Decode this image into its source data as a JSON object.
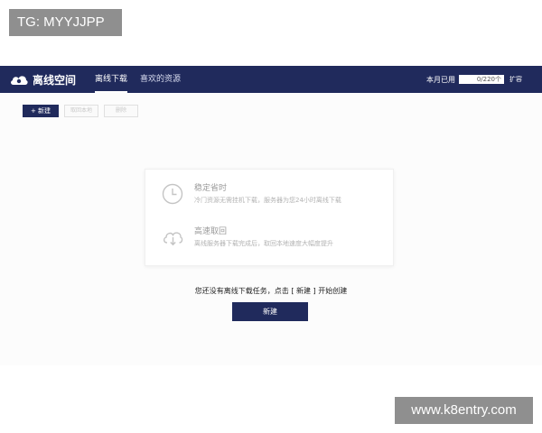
{
  "watermarks": {
    "top": "TG: MYYJJPP",
    "bottom": "www.k8entry.com"
  },
  "header": {
    "brand": "离线空间",
    "tabs": [
      {
        "label": "离线下载",
        "active": true
      },
      {
        "label": "喜欢的资源",
        "active": false
      }
    ],
    "quota_label": "本月已用",
    "quota_value": "0/220个",
    "expand_label": "扩容"
  },
  "toolbar": {
    "new_label": "+ 新建",
    "redownload_label": "取回本地",
    "delete_label": "删除"
  },
  "features": [
    {
      "icon": "clock-icon",
      "title": "稳定省时",
      "desc": "冷门资源无需挂机下载，服务器为您24小时离线下载"
    },
    {
      "icon": "cloud-download-icon",
      "title": "高速取回",
      "desc": "离线服务器下载完成后，取回本地速度大幅度提升"
    }
  ],
  "empty_state": {
    "message": "您还没有离线下载任务，点击 [ 新建 ] 开始创建",
    "button_label": "新建"
  },
  "colors": {
    "navbar": "#202a5c",
    "primary_button": "#202a5c"
  }
}
